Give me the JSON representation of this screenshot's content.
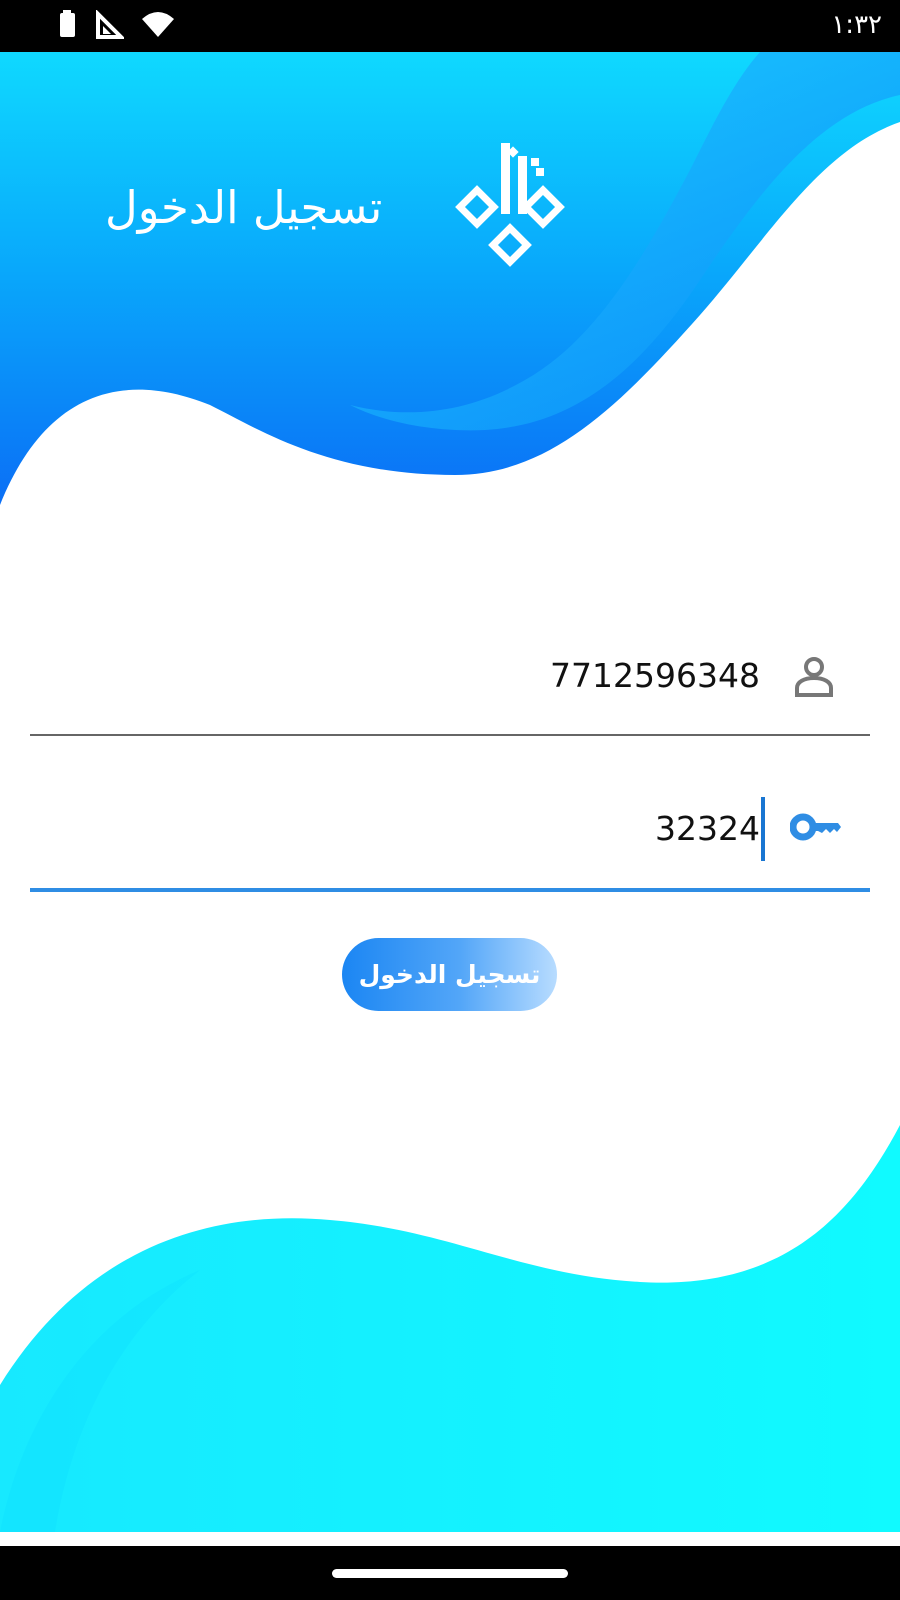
{
  "status_bar": {
    "time": "١:٣٢",
    "icons": [
      "battery-icon",
      "signal-icon",
      "wifi-icon"
    ]
  },
  "header": {
    "title": "تسجيل الدخول",
    "logo": "calligraphy-logo"
  },
  "form": {
    "username": {
      "value": "7712596348",
      "icon": "person-icon"
    },
    "password": {
      "value": "32324",
      "icon": "key-icon"
    },
    "login_button": "تسجيل الدخول"
  },
  "colors": {
    "header_gradient": [
      "#0ed7ff",
      "#0b73f7"
    ],
    "accent": "#2f8de4",
    "bottom_wave": "#10f7ff"
  }
}
